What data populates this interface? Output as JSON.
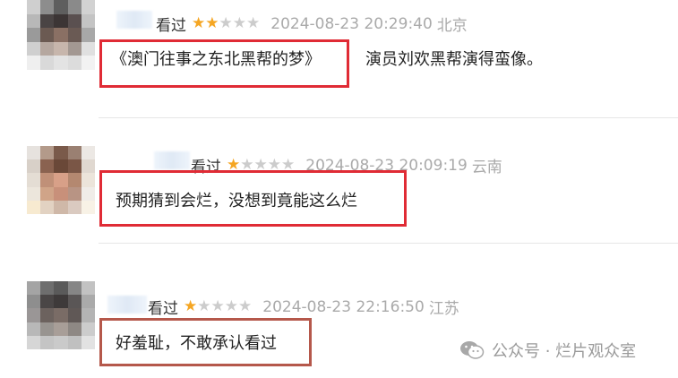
{
  "reviews": [
    {
      "seen": "看过",
      "rating": 2,
      "date": "2024-08-23 20:29:40",
      "location": "北京",
      "highlight": "《澳门往事之东北黑帮的梦》",
      "comment_rest": "演员刘欢黑帮演得蛮像。"
    },
    {
      "seen": "看过",
      "rating": 1,
      "date": "2024-08-23 20:09:19",
      "location": "云南",
      "highlight": "预期猜到会烂，没想到竟能这么烂",
      "comment_rest": ""
    },
    {
      "seen": "看过",
      "rating": 1,
      "date": "2024-08-23 22:16:50",
      "location": "江苏",
      "highlight": "好羞耻，不敢承认看过",
      "comment_rest": ""
    }
  ],
  "rating_max": 5,
  "colors": {
    "star_on": "#f5a623",
    "star_off": "#cccccc",
    "highlight_box": "#e02b35"
  },
  "watermark": {
    "text": "公众号 · 烂片观众室",
    "icon": "wechat-icon"
  }
}
